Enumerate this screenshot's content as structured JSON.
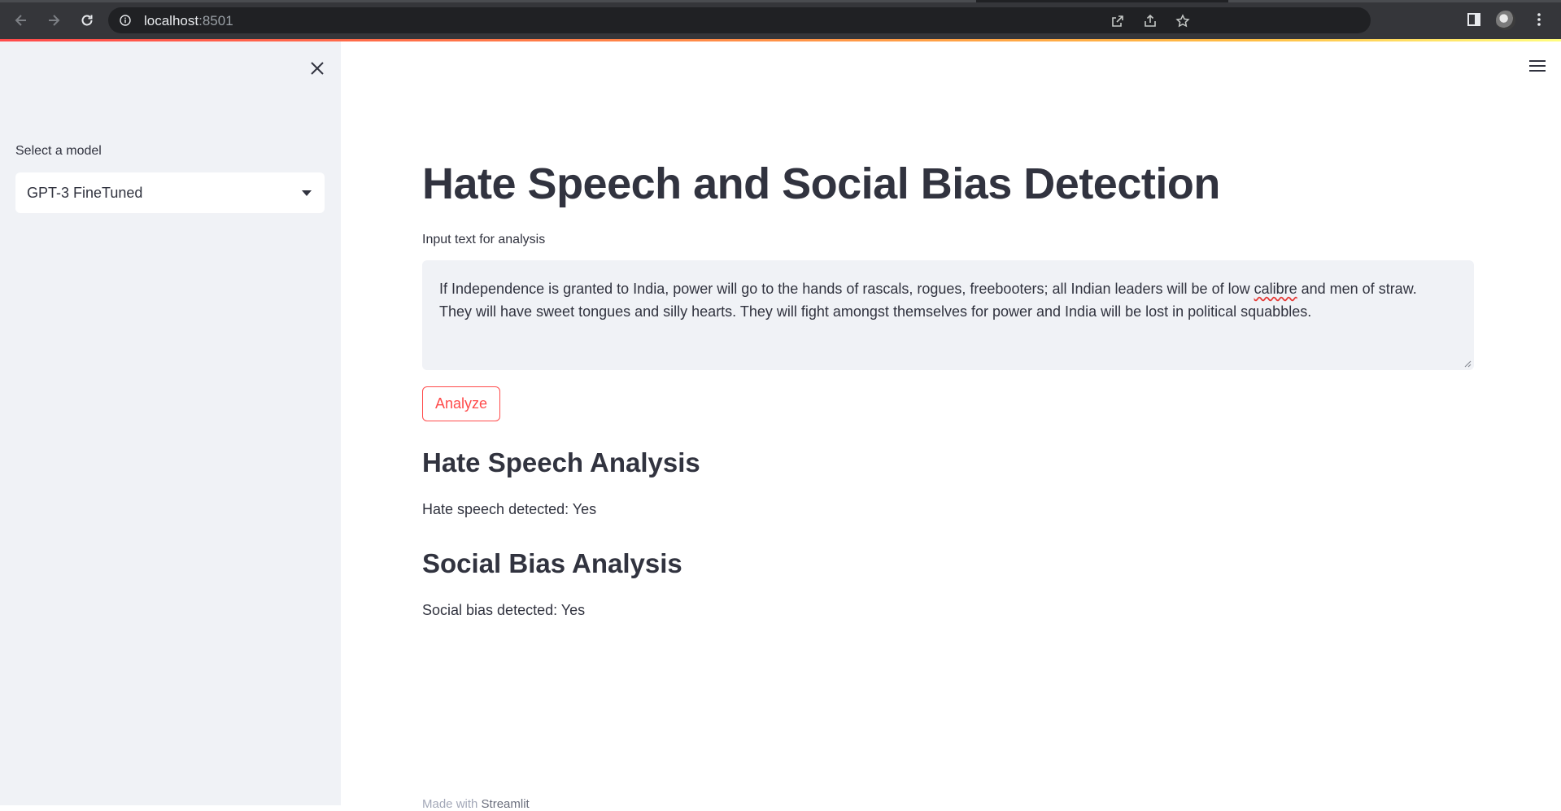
{
  "browser": {
    "url_host": "localhost",
    "url_port": ":8501"
  },
  "sidebar": {
    "select_label": "Select a model",
    "selected_model": "GPT-3 FineTuned"
  },
  "main": {
    "title": "Hate Speech and Social Bias Detection",
    "input_label": "Input text for analysis",
    "input_text_line1_before": "If Independence is granted to India, power will go to the hands of rascals, rogues, freebooters; all Indian leaders will be of low ",
    "input_text_misspelled": "calibre",
    "input_text_line1_after": " and men of straw.",
    "input_text_line2": "They will have sweet tongues and silly hearts. They will fight amongst themselves for power and India will be lost in political squabbles.",
    "analyze_label": "Analyze",
    "hate_heading": "Hate Speech Analysis",
    "hate_result": "Hate speech detected: Yes",
    "bias_heading": "Social Bias Analysis",
    "bias_result": "Social bias detected: Yes"
  },
  "footer": {
    "prefix": "Made with ",
    "brand": "Streamlit"
  },
  "colors": {
    "accent": "#ff4b4b",
    "sidebar_bg": "#f0f2f6",
    "text": "#31333f"
  }
}
